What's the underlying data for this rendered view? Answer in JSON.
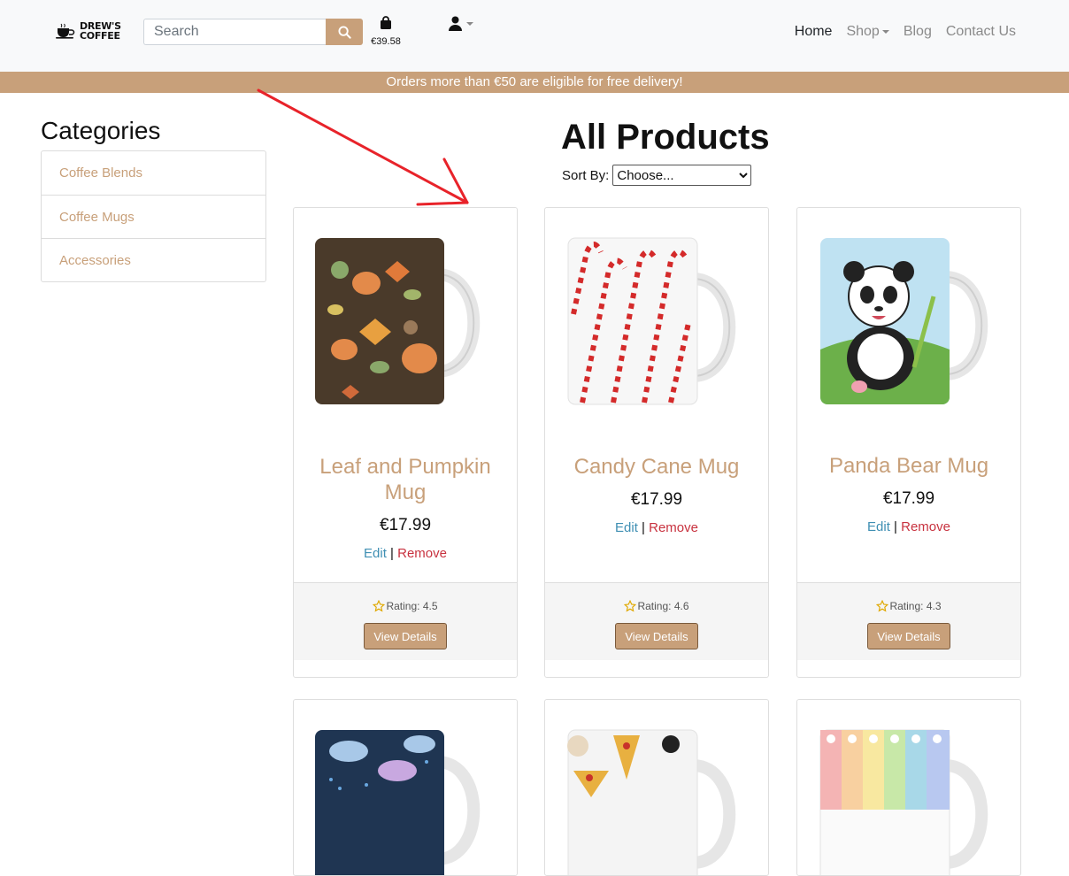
{
  "header": {
    "logo_line1": "DREW'S",
    "logo_line2": "COFFEE",
    "search_placeholder": "Search",
    "cart_total": "€39.58",
    "nav": {
      "home": "Home",
      "shop": "Shop",
      "blog": "Blog",
      "contact": "Contact Us"
    }
  },
  "banner": {
    "text": "Orders more than €50 are eligible for free delivery!"
  },
  "sidebar": {
    "title": "Categories",
    "items": [
      {
        "label": "Coffee Blends"
      },
      {
        "label": "Coffee Mugs"
      },
      {
        "label": "Accessories"
      }
    ]
  },
  "main": {
    "title": "All Products",
    "sort_label": "Sort By:",
    "sort_selected": "Choose..."
  },
  "products": [
    {
      "name": "Leaf and Pumpkin Mug",
      "price": "€17.99",
      "edit": "Edit",
      "sep": "|",
      "remove": "Remove",
      "rating": "Rating: 4.5",
      "button": "View Details",
      "image_icon": "leaf-pumpkin-mug-image"
    },
    {
      "name": "Candy Cane Mug",
      "price": "€17.99",
      "edit": "Edit",
      "sep": "|",
      "remove": "Remove",
      "rating": "Rating: 4.6",
      "button": "View Details",
      "image_icon": "candy-cane-mug-image"
    },
    {
      "name": "Panda Bear Mug",
      "price": "€17.99",
      "edit": "Edit",
      "sep": "|",
      "remove": "Remove",
      "rating": "Rating: 4.3",
      "button": "View Details",
      "image_icon": "panda-bear-mug-image"
    }
  ],
  "colors": {
    "accent": "#c8a07a",
    "edit_link": "#3f8fb3",
    "remove_link": "#c8323f",
    "annotation_arrow": "#e8232a"
  }
}
